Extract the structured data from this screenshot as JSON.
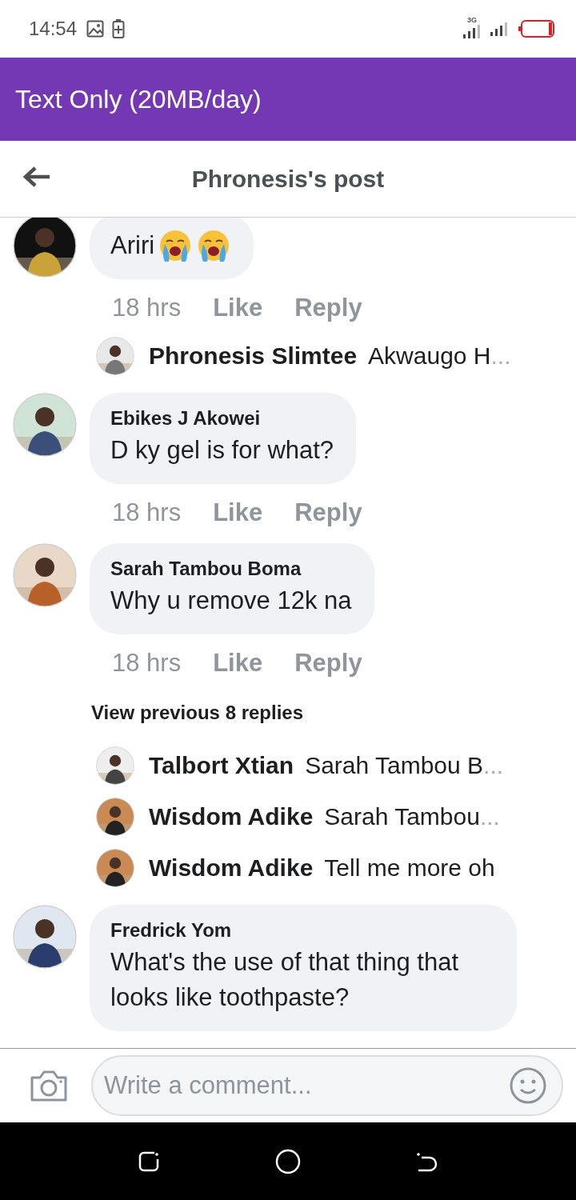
{
  "status_bar": {
    "time": "14:54",
    "network": "3G"
  },
  "data_banner": {
    "title": "Text Only (20MB/day)"
  },
  "header": {
    "title": "Phronesis's post"
  },
  "items": [
    {
      "kind": "comment",
      "text": "Ariri",
      "emojis": [
        {
          "kind": "crying"
        },
        {
          "kind": "crying"
        }
      ],
      "time": "18 hrs",
      "like": "Like",
      "reply": "Reply"
    },
    {
      "kind": "reply_preview",
      "author": "Phronesis Slimtee",
      "preview": "Akwaugo H",
      "ellipsis": "..."
    },
    {
      "kind": "comment",
      "author": "Ebikes J Akowei",
      "text": "D ky gel is for what?",
      "time": "18 hrs",
      "like": "Like",
      "reply": "Reply"
    },
    {
      "kind": "comment",
      "author": "Sarah Tambou Boma",
      "text": "Why u remove 12k na",
      "time": "18 hrs",
      "like": "Like",
      "reply": "Reply"
    },
    {
      "kind": "view_more",
      "label": "View previous 8 replies"
    },
    {
      "kind": "reply_preview",
      "author": "Talbort Xtian",
      "preview": "Sarah Tambou B",
      "ellipsis": "..."
    },
    {
      "kind": "reply_preview",
      "author": "Wisdom Adike",
      "preview": "Sarah Tambou",
      "ellipsis": "..."
    },
    {
      "kind": "reply_preview",
      "author": "Wisdom Adike",
      "preview": "Tell me more oh"
    },
    {
      "kind": "comment",
      "author": "Fredrick Yom",
      "text": "What's the use of that thing that looks like toothpaste?"
    }
  ],
  "composer": {
    "placeholder": "Write a comment..."
  }
}
